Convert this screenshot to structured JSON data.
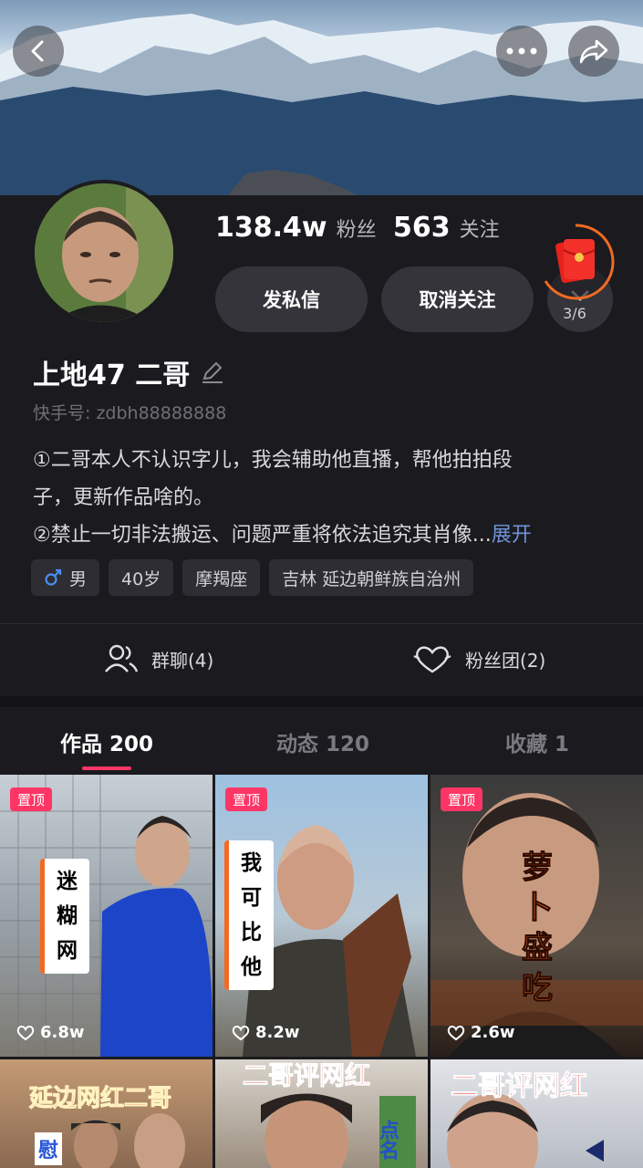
{
  "stats": {
    "followers_num": "138.4w",
    "followers_label": "粉丝",
    "following_num": "563",
    "following_label": "关注"
  },
  "buttons": {
    "message": "发私信",
    "unfollow": "取消关注",
    "redpacket_count": "3/6"
  },
  "profile": {
    "name": "上地47 二哥",
    "uid": "快手号: zdbh88888888",
    "bio_line1": "①二哥本人不认识字儿，我会辅助他直播，帮他拍拍段",
    "bio_line2": "子，更新作品啥的。",
    "bio_line3": "②禁止一切非法搬运、问题严重将依法追究其肖像...",
    "bio_expand": "展开"
  },
  "tags": {
    "gender": "男",
    "age": "40岁",
    "zodiac": "摩羯座",
    "location": "吉林 延边朝鲜族自治州"
  },
  "actions": {
    "group_chat": "群聊(4)",
    "fan_club": "粉丝团(2)"
  },
  "tabs": {
    "works": "作品 200",
    "moments": "动态 120",
    "favorites": "收藏 1"
  },
  "videos": [
    {
      "pinned": "置顶",
      "likes": "6.8w",
      "caption": [
        "迷",
        "糊",
        "网"
      ]
    },
    {
      "pinned": "置顶",
      "likes": "8.2w",
      "caption": [
        "我",
        "可",
        "比",
        "他"
      ]
    },
    {
      "pinned": "置顶",
      "likes": "2.6w",
      "caption": [
        "萝",
        "卜",
        "盛",
        "吃"
      ]
    },
    {
      "caption_text": "延边网红二哥",
      "side_text": "慰"
    },
    {
      "caption_text": "二哥评网红",
      "side_text": "点名"
    },
    {
      "caption_text": "二哥评网红"
    }
  ],
  "colors": {
    "accent": "#fe3666",
    "background": "#1b1b1f",
    "link": "#6f93d8"
  },
  "icons": [
    "back-icon",
    "more-icon",
    "share-icon",
    "edit-icon",
    "gender-male-icon",
    "group-icon",
    "heart-outline-icon",
    "red-packet-icon",
    "chevron-down-icon"
  ]
}
